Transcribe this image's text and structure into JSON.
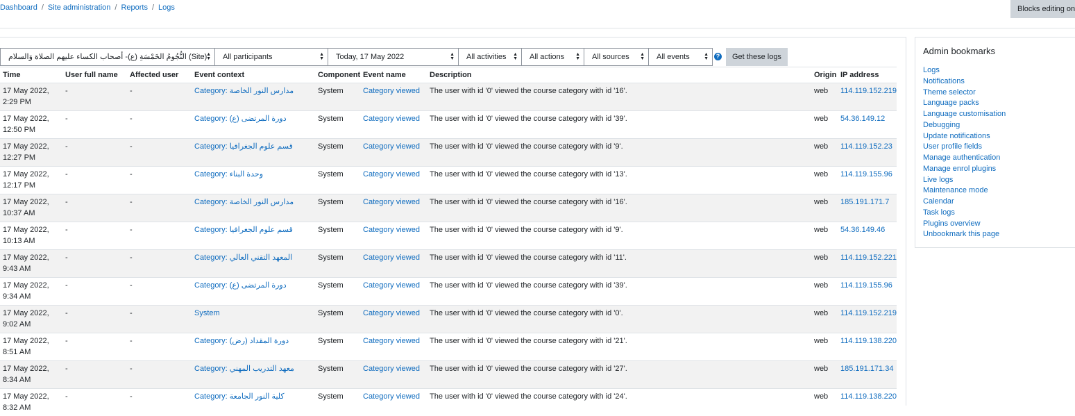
{
  "breadcrumb": [
    "Dashboard",
    "Site administration",
    "Reports",
    "Logs"
  ],
  "blocks_editing_label": "Blocks editing on",
  "filters": {
    "course": "النُّجُومُ الخَمْسَةِ (ع)- أصحاب الكساء عليهم الصلاة وَالسلام (Site)",
    "participants": "All participants",
    "date": "Today, 17 May 2022",
    "activities": "All activities",
    "actions": "All actions",
    "sources": "All sources",
    "events": "All events",
    "help_icon": "question-circle-icon",
    "submit_label": "Get these logs"
  },
  "table": {
    "headers": [
      "Time",
      "User full name",
      "Affected user",
      "Event context",
      "Component",
      "Event name",
      "Description",
      "Origin",
      "IP address"
    ],
    "rows": [
      {
        "time1": "17 May 2022,",
        "time2": "2:29 PM",
        "user": "-",
        "affected": "-",
        "context": "Category: مدارس النور الخاصة",
        "component": "System",
        "event": "Category viewed",
        "description": "The user with id '0' viewed the course category with id '16'.",
        "origin": "web",
        "ip": "114.119.152.219"
      },
      {
        "time1": "17 May 2022,",
        "time2": "12:50 PM",
        "user": "-",
        "affected": "-",
        "context": "Category: دورة المرتضى (ع)",
        "component": "System",
        "event": "Category viewed",
        "description": "The user with id '0' viewed the course category with id '39'.",
        "origin": "web",
        "ip": "54.36.149.12"
      },
      {
        "time1": "17 May 2022,",
        "time2": "12:27 PM",
        "user": "-",
        "affected": "-",
        "context": "Category: قسم علوم الجغرافيا",
        "component": "System",
        "event": "Category viewed",
        "description": "The user with id '0' viewed the course category with id '9'.",
        "origin": "web",
        "ip": "114.119.152.23"
      },
      {
        "time1": "17 May 2022,",
        "time2": "12:17 PM",
        "user": "-",
        "affected": "-",
        "context": "Category: وحدة البناء",
        "component": "System",
        "event": "Category viewed",
        "description": "The user with id '0' viewed the course category with id '13'.",
        "origin": "web",
        "ip": "114.119.155.96"
      },
      {
        "time1": "17 May 2022,",
        "time2": "10:37 AM",
        "user": "-",
        "affected": "-",
        "context": "Category: مدارس النور الخاصة",
        "component": "System",
        "event": "Category viewed",
        "description": "The user with id '0' viewed the course category with id '16'.",
        "origin": "web",
        "ip": "185.191.171.7"
      },
      {
        "time1": "17 May 2022,",
        "time2": "10:13 AM",
        "user": "-",
        "affected": "-",
        "context": "Category: قسم علوم الجغرافيا",
        "component": "System",
        "event": "Category viewed",
        "description": "The user with id '0' viewed the course category with id '9'.",
        "origin": "web",
        "ip": "54.36.149.46"
      },
      {
        "time1": "17 May 2022,",
        "time2": "9:43 AM",
        "user": "-",
        "affected": "-",
        "context": "Category: المعهد التقني العالي",
        "component": "System",
        "event": "Category viewed",
        "description": "The user with id '0' viewed the course category with id '11'.",
        "origin": "web",
        "ip": "114.119.152.221"
      },
      {
        "time1": "17 May 2022,",
        "time2": "9:34 AM",
        "user": "-",
        "affected": "-",
        "context": "Category: دورة المرتضى (ع)",
        "component": "System",
        "event": "Category viewed",
        "description": "The user with id '0' viewed the course category with id '39'.",
        "origin": "web",
        "ip": "114.119.155.96"
      },
      {
        "time1": "17 May 2022,",
        "time2": "9:02 AM",
        "user": "-",
        "affected": "-",
        "context": "System",
        "component": "System",
        "event": "Category viewed",
        "description": "The user with id '0' viewed the course category with id '0'.",
        "origin": "web",
        "ip": "114.119.152.219"
      },
      {
        "time1": "17 May 2022,",
        "time2": "8:51 AM",
        "user": "-",
        "affected": "-",
        "context": "Category: دورة المقداد (رض)",
        "component": "System",
        "event": "Category viewed",
        "description": "The user with id '0' viewed the course category with id '21'.",
        "origin": "web",
        "ip": "114.119.138.220"
      },
      {
        "time1": "17 May 2022,",
        "time2": "8:34 AM",
        "user": "-",
        "affected": "-",
        "context": "Category: معهد التدريب المهني",
        "component": "System",
        "event": "Category viewed",
        "description": "The user with id '0' viewed the course category with id '27'.",
        "origin": "web",
        "ip": "185.191.171.34"
      },
      {
        "time1": "17 May 2022,",
        "time2": "8:32 AM",
        "user": "-",
        "affected": "-",
        "context": "Category: كلية النور الجامعة",
        "component": "System",
        "event": "Category viewed",
        "description": "The user with id '0' viewed the course category with id '24'.",
        "origin": "web",
        "ip": "114.119.138.220"
      }
    ]
  },
  "admin_bookmarks": {
    "title": "Admin bookmarks",
    "links": [
      "Logs",
      "Notifications",
      "Theme selector",
      "Language packs",
      "Language customisation",
      "Debugging",
      "Update notifications",
      "User profile fields",
      "Manage authentication",
      "Manage enrol plugins",
      "Live logs",
      "Maintenance mode",
      "Calendar",
      "Task logs",
      "Plugins overview",
      "Unbookmark this page"
    ]
  }
}
